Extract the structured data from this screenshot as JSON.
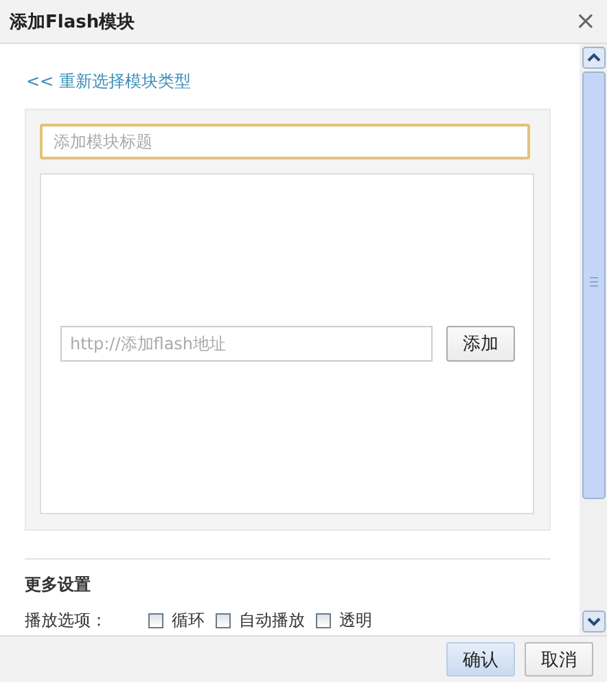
{
  "dialog": {
    "title": "添加Flash模块",
    "close": "×"
  },
  "back_link": "<< 重新选择模块类型",
  "title_field": {
    "placeholder": "添加模块标题"
  },
  "url_field": {
    "placeholder": "http://添加flash地址"
  },
  "add_button": "添加",
  "more_settings": {
    "heading": "更多设置",
    "label": "播放选项：",
    "options": [
      {
        "label": "循环",
        "checked": false
      },
      {
        "label": "自动播放",
        "checked": false
      },
      {
        "label": "透明",
        "checked": false
      }
    ]
  },
  "buttons": [
    {
      "label": "确认",
      "kind": "primary"
    },
    {
      "label": "取消",
      "kind": "secondary"
    }
  ]
}
